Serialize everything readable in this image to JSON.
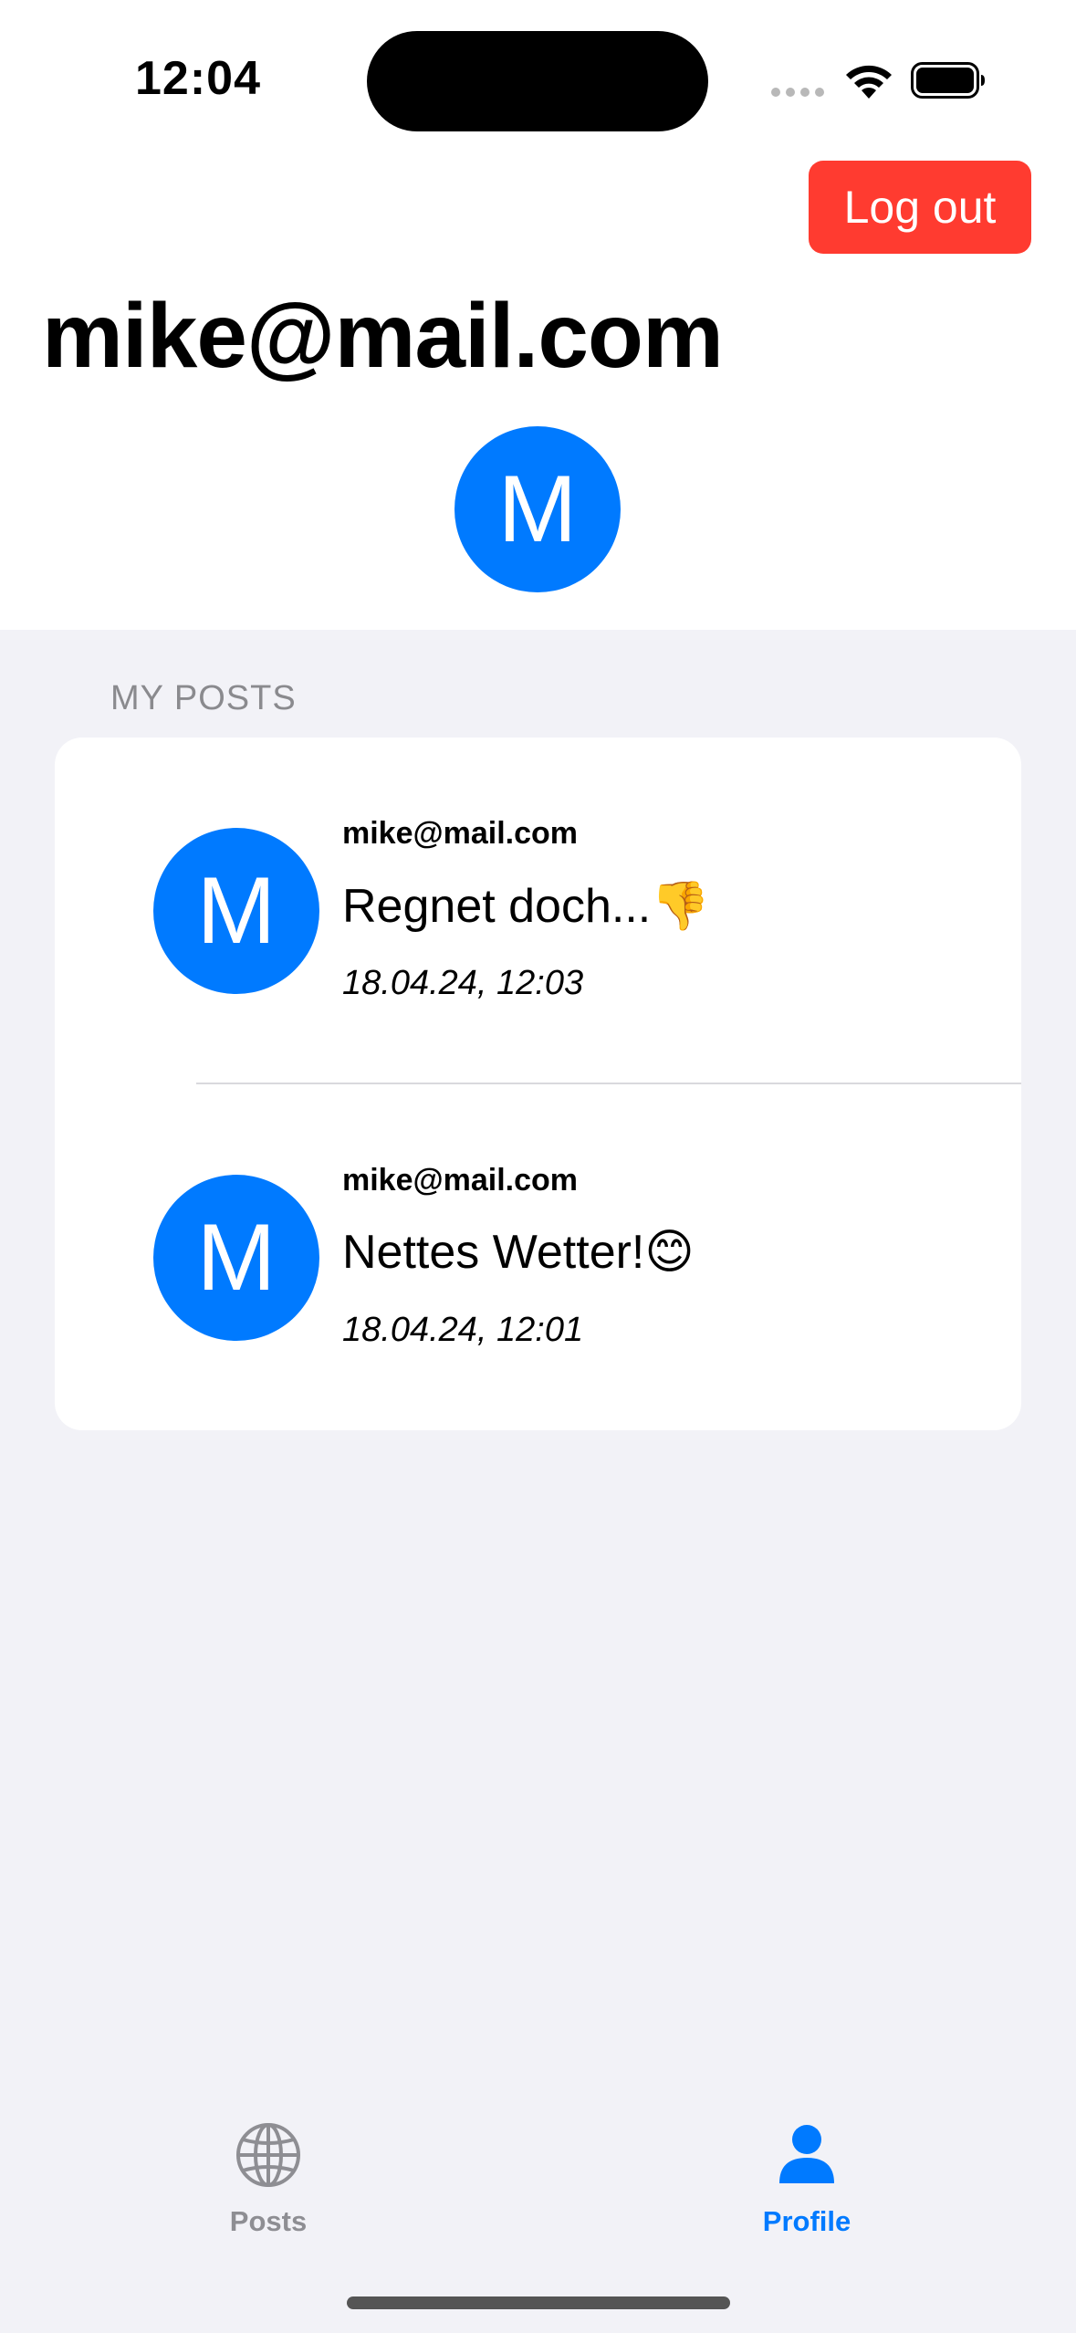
{
  "status_bar": {
    "time": "12:04"
  },
  "header": {
    "logout_label": "Log out",
    "title": "mike@mail.com",
    "avatar_initial": "M"
  },
  "posts_section": {
    "header": "MY POSTS",
    "posts": [
      {
        "avatar_initial": "M",
        "author": "mike@mail.com",
        "text": "Regnet doch...👎",
        "date": "18.04.24, 12:03"
      },
      {
        "avatar_initial": "M",
        "author": "mike@mail.com",
        "text": "Nettes Wetter!😊",
        "date": "18.04.24, 12:01"
      }
    ]
  },
  "tab_bar": {
    "tabs": [
      {
        "label": "Posts",
        "icon": "globe-icon",
        "selected": false
      },
      {
        "label": "Profile",
        "icon": "person-icon",
        "selected": true
      }
    ]
  },
  "colors": {
    "accent": "#007aff",
    "destructive": "#ff3b30",
    "inactive_tab": "#8e8e93",
    "background": "#f2f2f7"
  }
}
